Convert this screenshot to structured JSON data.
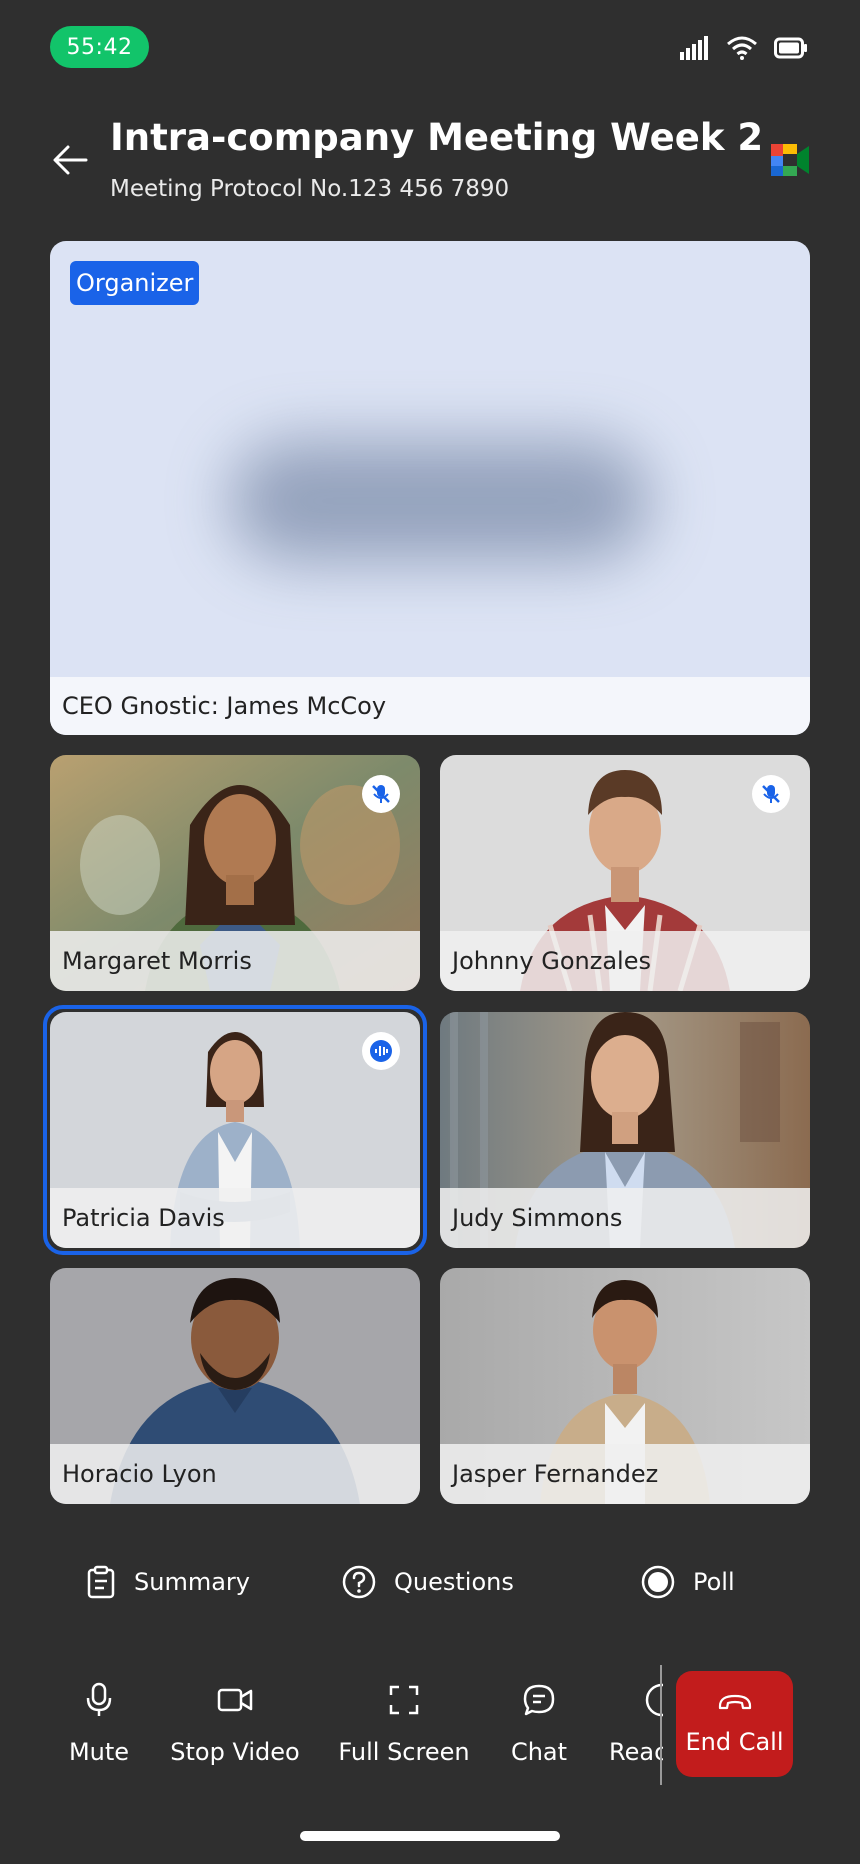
{
  "status_bar": {
    "time": "55:42"
  },
  "header": {
    "title": "Intra-company Meeting Week 2",
    "subtitle": "Meeting Protocol No.123 456 7890"
  },
  "organizer": {
    "badge": "Organizer",
    "name": "CEO Gnostic: James McCoy"
  },
  "participants": [
    {
      "name": "Margaret Morris",
      "mic": "muted"
    },
    {
      "name": "Johnny Gonzales",
      "mic": "muted"
    },
    {
      "name": "Patricia Davis",
      "mic": "speaking",
      "active": true
    },
    {
      "name": "Judy Simmons"
    },
    {
      "name": "Horacio Lyon"
    },
    {
      "name": "Jasper Fernandez"
    }
  ],
  "features": [
    {
      "label": "Summary",
      "icon": "clipboard-icon"
    },
    {
      "label": "Questions",
      "icon": "question-circle-icon"
    },
    {
      "label": "Poll",
      "icon": "radio-icon"
    }
  ],
  "toolbar": {
    "mute": "Mute",
    "stop_video": "Stop Video",
    "full_screen": "Full Screen",
    "chat": "Chat",
    "react": "Reac",
    "end_call": "End Call"
  },
  "colors": {
    "background": "#2f2f2f",
    "accent": "#1a63e8",
    "time_badge": "#12c46a",
    "end_call": "#c21c1c"
  }
}
